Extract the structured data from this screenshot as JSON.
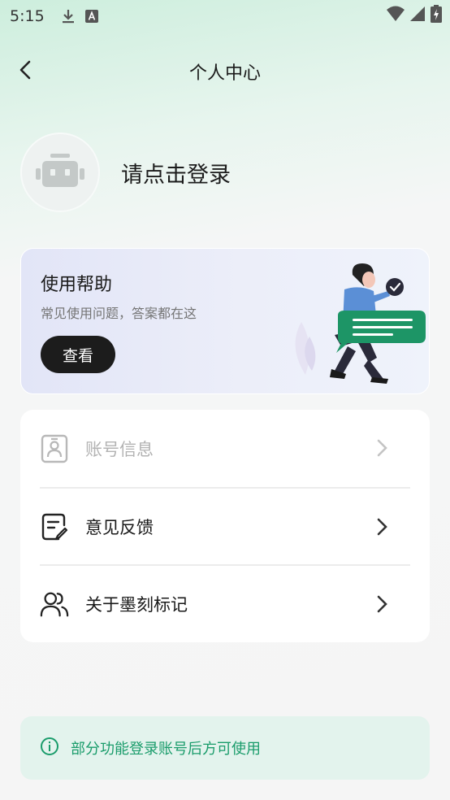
{
  "status_bar": {
    "time": "5:15",
    "left_icons": [
      "download-icon",
      "font-icon"
    ],
    "right_icons": [
      "wifi-icon",
      "signal-icon",
      "battery-icon"
    ]
  },
  "nav": {
    "title": "个人中心",
    "back_icon": "chevron-left-icon"
  },
  "profile": {
    "avatar_icon": "robot-icon",
    "login_prompt": "请点击登录"
  },
  "help_card": {
    "title": "使用帮助",
    "subtitle": "常见使用问题，答案都在这",
    "button_label": "查看",
    "illustration": "person-with-speech-bubble"
  },
  "menu": {
    "items": [
      {
        "label": "账号信息",
        "icon": "id-card-icon",
        "enabled": false
      },
      {
        "label": "意见反馈",
        "icon": "feedback-icon",
        "enabled": true
      },
      {
        "label": "关于墨刻标记",
        "icon": "users-icon",
        "enabled": true
      }
    ]
  },
  "notice": {
    "icon": "info-icon",
    "text": "部分功能登录账号后方可使用"
  },
  "colors": {
    "accent": "#1a9c6b",
    "illustration_green": "#1d9566",
    "button_dark": "#1c1c1c",
    "disabled_text": "#b3b3b3"
  }
}
